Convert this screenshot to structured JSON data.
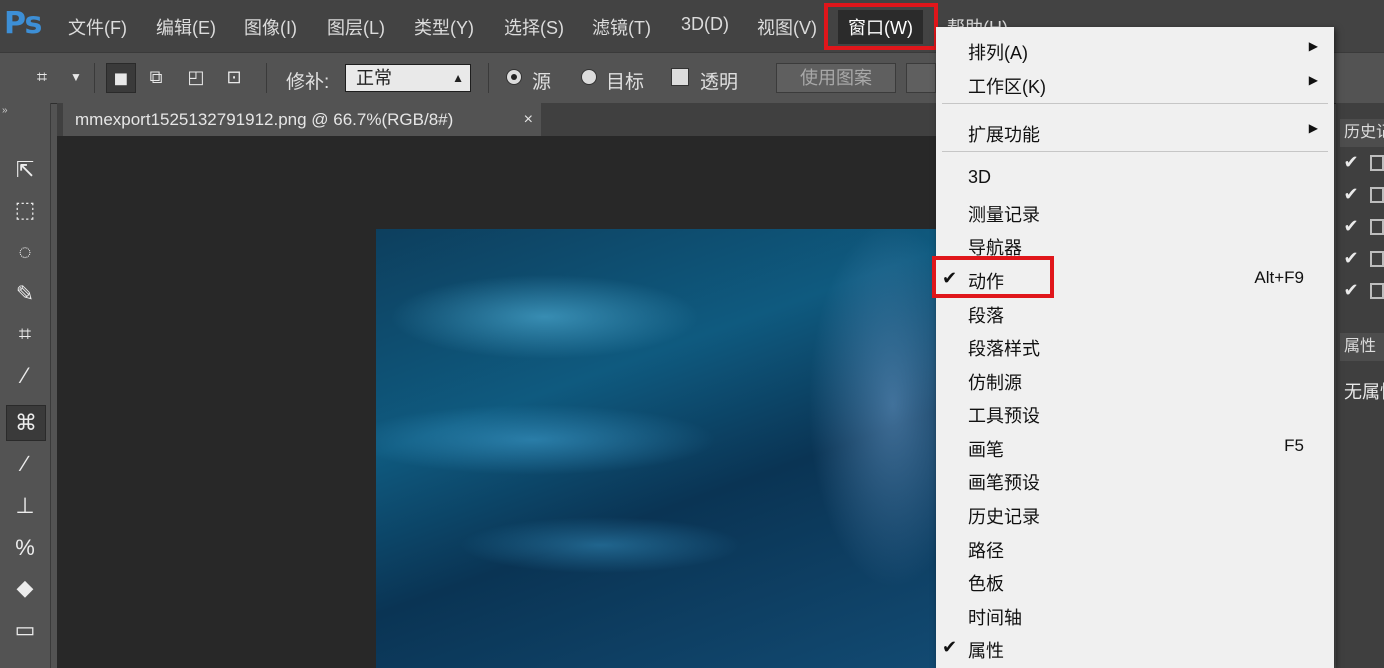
{
  "app": {
    "logo": "Ps"
  },
  "menubar": {
    "items": [
      "文件(F)",
      "编辑(E)",
      "图像(I)",
      "图层(L)",
      "类型(Y)",
      "选择(S)",
      "滤镜(T)",
      "3D(D)",
      "视图(V)",
      "窗口(W)",
      "帮助(H)"
    ],
    "active": "窗口(W)"
  },
  "options": {
    "patch_label": "修补:",
    "mode_value": "正常",
    "source_label": "源",
    "target_label": "目标",
    "transparent_label": "透明",
    "use_pattern_label": "使用图案"
  },
  "document": {
    "tab_title": "mmexport1525132791912.png @ 66.7%(RGB/8#)",
    "close": "×"
  },
  "right_panel": {
    "history_tab": "历史记",
    "properties_tab": "属性",
    "properties_text": "无属性"
  },
  "window_menu": {
    "arrange": "排列(A)",
    "workspace": "工作区(K)",
    "extensions": "扩展功能",
    "items": [
      {
        "label": "3D",
        "checked": false,
        "shortcut": ""
      },
      {
        "label": "测量记录",
        "checked": false,
        "shortcut": ""
      },
      {
        "label": "导航器",
        "checked": false,
        "shortcut": ""
      },
      {
        "label": "动作",
        "checked": true,
        "shortcut": "Alt+F9"
      },
      {
        "label": "段落",
        "checked": false,
        "shortcut": ""
      },
      {
        "label": "段落样式",
        "checked": false,
        "shortcut": ""
      },
      {
        "label": "仿制源",
        "checked": false,
        "shortcut": ""
      },
      {
        "label": "工具预设",
        "checked": false,
        "shortcut": ""
      },
      {
        "label": "画笔",
        "checked": false,
        "shortcut": "F5"
      },
      {
        "label": "画笔预设",
        "checked": false,
        "shortcut": ""
      },
      {
        "label": "历史记录",
        "checked": false,
        "shortcut": ""
      },
      {
        "label": "路径",
        "checked": false,
        "shortcut": ""
      },
      {
        "label": "色板",
        "checked": false,
        "shortcut": ""
      },
      {
        "label": "时间轴",
        "checked": false,
        "shortcut": ""
      },
      {
        "label": "属性",
        "checked": true,
        "shortcut": ""
      }
    ],
    "check_glyph": "✔"
  },
  "colors": {
    "highlight": "#e0161b",
    "menu_bg": "#f0f0f0",
    "app_bg": "#535353"
  }
}
